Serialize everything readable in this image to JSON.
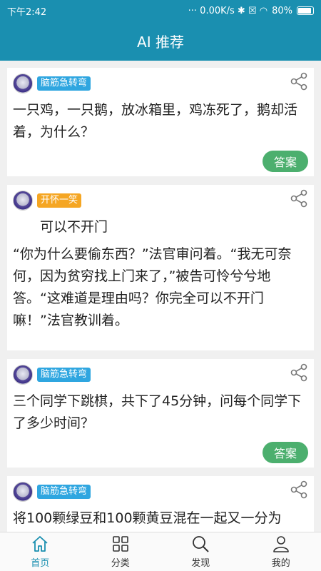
{
  "status_bar": {
    "time": "下午2:42",
    "indicators": "··· 0.00K/s ✱ ☒ ◠",
    "battery": "80%"
  },
  "header": {
    "title": "AI 推荐"
  },
  "feed": {
    "cards": [
      {
        "tag": "脑筋急转弯",
        "tag_color": "#2fa6e0",
        "text": "一只鸡，一只鹅，放冰箱里，鸡冻死了，鹅却活着，为什么？",
        "answer_label": "答案"
      },
      {
        "tag": "开怀一笑",
        "tag_color": "#f5a623",
        "text_lines": [
          "可以不开门",
          "“你为什么要偷东西？”法官审问着。“我无可奈何，因为贫穷找上门来了，”被告可怜兮兮地答。“这难道是理由吗？你完全可以不开门嘛！”法官教训着。"
        ]
      },
      {
        "tag": "脑筋急转弯",
        "tag_color": "#2fa6e0",
        "text": "三个同学下跳棋，共下了45分钟，问每个同学下了多少时间？",
        "answer_label": "答案"
      },
      {
        "tag": "脑筋急转弯",
        "tag_color": "#2fa6e0",
        "text": "将100颗绿豆和100颗黄豆混在一起又一分为"
      }
    ]
  },
  "tabbar": {
    "items": [
      {
        "label": "首页",
        "icon": "home-icon",
        "active": true
      },
      {
        "label": "分类",
        "icon": "grid-icon"
      },
      {
        "label": "发现",
        "icon": "search-icon"
      },
      {
        "label": "我的",
        "icon": "person-icon"
      }
    ]
  }
}
